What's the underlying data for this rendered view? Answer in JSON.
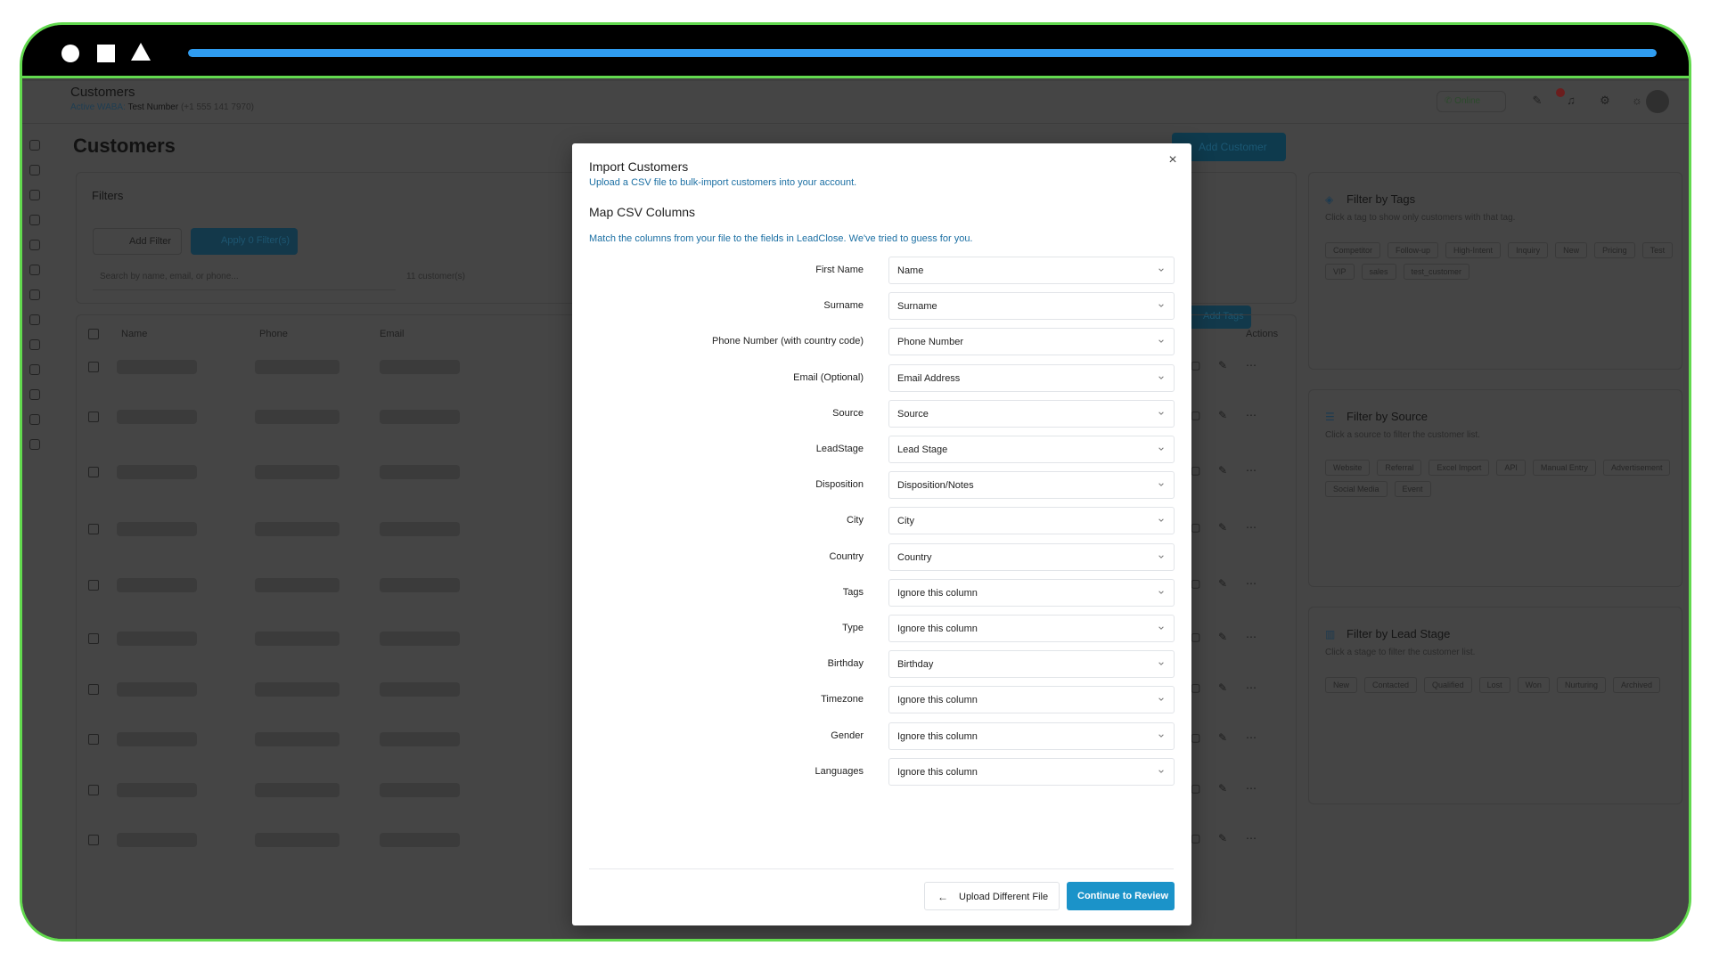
{
  "window": {
    "progress_percent": 100
  },
  "header": {
    "title": "Customers",
    "waba_label": "Active WABA:",
    "waba_number_name": "Test Number",
    "waba_phone": "(+1 555 141 7970)",
    "status": "Online"
  },
  "page": {
    "title": "Customers",
    "add_customer_label": "Add Customer"
  },
  "filters": {
    "title": "Filters",
    "add_filter_label": "Add Filter",
    "apply_label": "Apply 0 Filter(s)",
    "search_placeholder": "Search by name, email, or phone...",
    "count_text": "11 customer(s)",
    "add_tags_label": "Add Tags"
  },
  "table": {
    "headers": [
      "Name",
      "Phone",
      "Email",
      "Actions"
    ],
    "row_count": 10
  },
  "side": {
    "tags": {
      "title": "Filter by Tags",
      "subtitle": "Click a tag to show only customers with that tag.",
      "chips_row1": [
        "Competitor",
        "Follow-up",
        "High-Intent",
        "Inquiry",
        "New",
        "Pricing",
        "Test"
      ],
      "chips_row2": [
        "VIP",
        "sales",
        "test_customer"
      ]
    },
    "source": {
      "title": "Filter by Source",
      "subtitle": "Click a source to filter the customer list.",
      "chips_row1": [
        "Website",
        "Referral",
        "Excel Import",
        "API",
        "Manual Entry",
        "Advertisement"
      ],
      "chips_row2": [
        "Social Media",
        "Event"
      ]
    },
    "stage": {
      "title": "Filter by Lead Stage",
      "subtitle": "Click a stage to filter the customer list.",
      "chips_row1": [
        "New",
        "Contacted",
        "Qualified",
        "Lost",
        "Won",
        "Nurturing",
        "Archived"
      ]
    }
  },
  "modal": {
    "title": "Import Customers",
    "subtitle": "Upload a CSV file to bulk-import customers into your account.",
    "section_title": "Map CSV Columns",
    "section_subtitle": "Match the columns from your file to the fields in LeadClose. We've tried to guess for you.",
    "close_glyph": "×",
    "mappings": [
      {
        "label": "First Name",
        "value": "Name"
      },
      {
        "label": "Surname",
        "value": "Surname"
      },
      {
        "label": "Phone Number (with country code)",
        "value": "Phone Number"
      },
      {
        "label": "Email (Optional)",
        "value": "Email Address"
      },
      {
        "label": "Source",
        "value": "Source"
      },
      {
        "label": "LeadStage",
        "value": "Lead Stage"
      },
      {
        "label": "Disposition",
        "value": "Disposition/Notes"
      },
      {
        "label": "City",
        "value": "City"
      },
      {
        "label": "Country",
        "value": "Country"
      },
      {
        "label": "Tags",
        "value": "Ignore this column"
      },
      {
        "label": "Type",
        "value": "Ignore this column"
      },
      {
        "label": "Birthday",
        "value": "Birthday"
      },
      {
        "label": "Timezone",
        "value": "Ignore this column"
      },
      {
        "label": "Gender",
        "value": "Ignore this column"
      },
      {
        "label": "Languages",
        "value": "Ignore this column"
      }
    ],
    "upload_label": "Upload Different File",
    "continue_label": "Continue to Review"
  },
  "colors": {
    "frame_border": "#62d94e",
    "progress": "#2f9cf0",
    "primary_button": "#1b93c9",
    "link_text": "#1b6fa3"
  },
  "icons": [
    "circle-icon",
    "square-icon",
    "triangle-icon",
    "close-icon",
    "chevron-down-icon",
    "arrow-left-icon",
    "tag-icon",
    "filter-icon",
    "bar-chart-icon",
    "phone-icon",
    "bell-icon",
    "settings-icon",
    "sun-icon"
  ]
}
